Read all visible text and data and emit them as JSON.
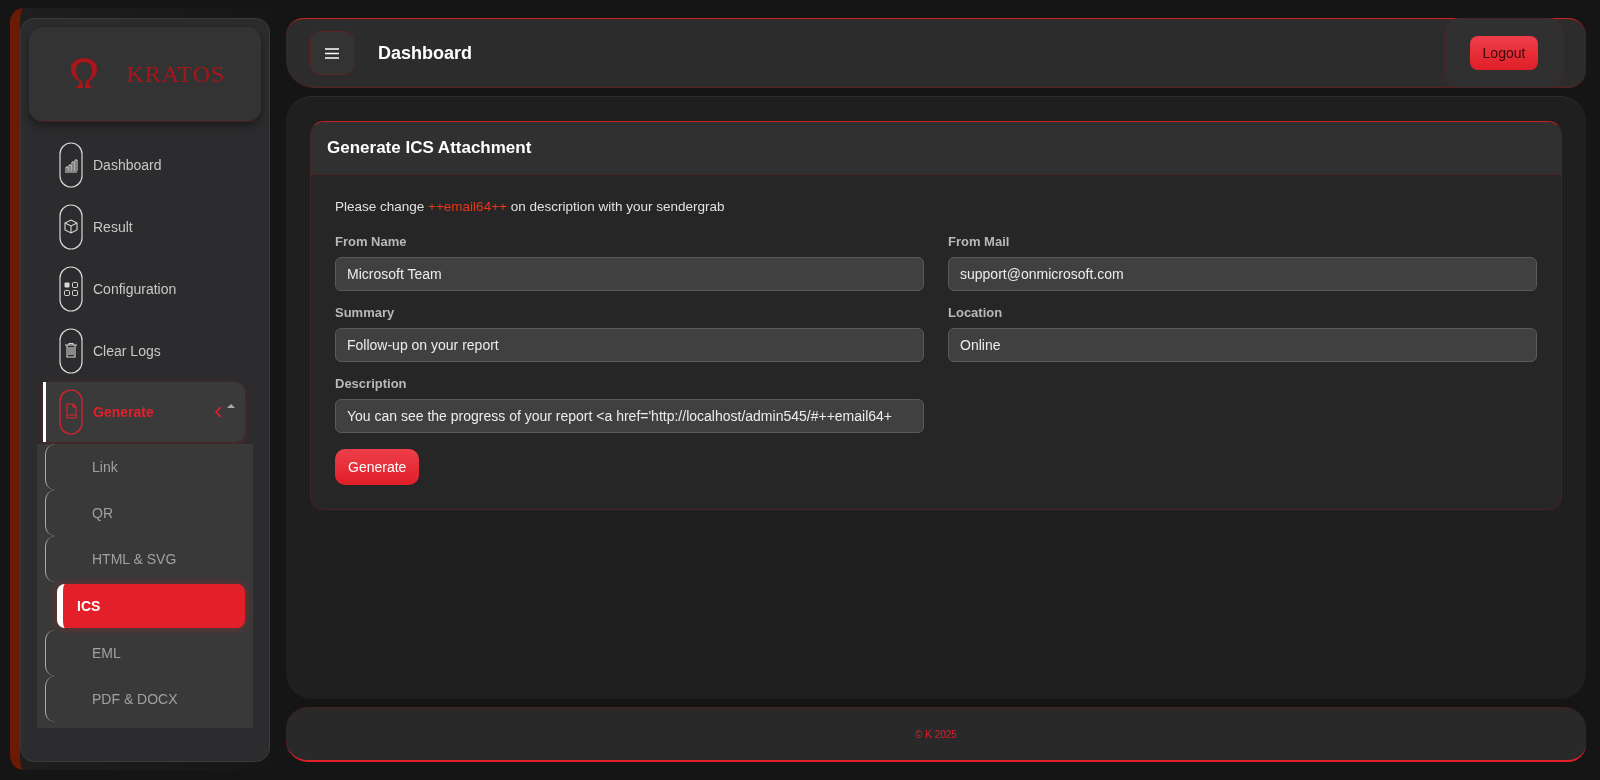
{
  "sidebar": {
    "logo": "KRATOS",
    "items": [
      {
        "label": "Dashboard",
        "selected": false
      },
      {
        "label": "Result",
        "selected": false
      },
      {
        "label": "Configuration",
        "selected": false
      },
      {
        "label": "Clear Logs",
        "selected": false
      },
      {
        "label": "Generate",
        "selected": true,
        "expanded": true,
        "children": [
          {
            "label": "Link",
            "selected": false
          },
          {
            "label": "QR",
            "selected": false
          },
          {
            "label": "HTML & SVG",
            "selected": false
          },
          {
            "label": "ICS",
            "selected": true
          },
          {
            "label": "EML",
            "selected": false
          },
          {
            "label": "PDF & DOCX",
            "selected": false
          }
        ]
      }
    ]
  },
  "header": {
    "title": "Dashboard",
    "logout": "Logout"
  },
  "card": {
    "title": "Generate ICS Attachment",
    "notice": {
      "before": "Please change",
      "highlight": "++email64++",
      "after": "on description with your sendergrab"
    },
    "fields": [
      {
        "label": "From Name",
        "value": "Microsoft Team"
      },
      {
        "label": "From Mail",
        "value": "support@onmicrosoft.com"
      },
      {
        "label": "Summary",
        "value": "Follow-up on your report"
      },
      {
        "label": "Location",
        "value": "Online"
      },
      {
        "label": "Description",
        "value": "You can see the progress of your report <a href='http://localhost/admin545/#++email64+"
      }
    ],
    "button": "Generate"
  },
  "footer": "© K 2025"
}
